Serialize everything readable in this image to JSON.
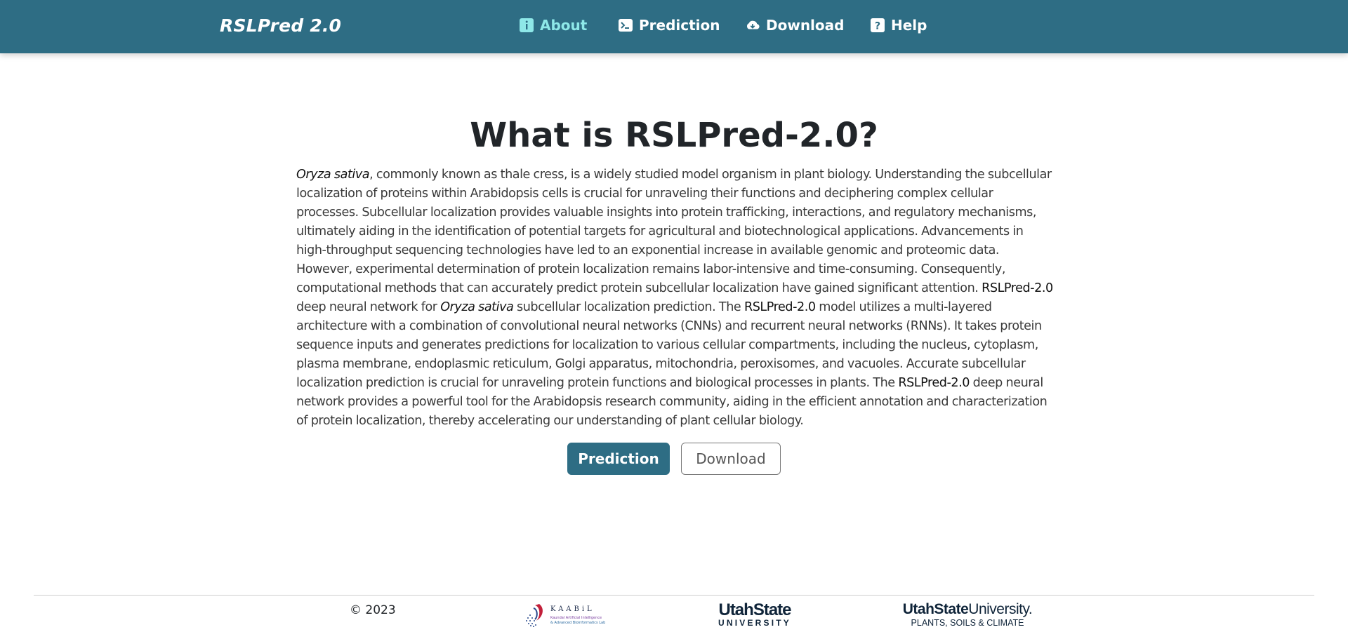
{
  "brand": "RSLPred 2.0",
  "nav": {
    "items": [
      {
        "label": "About",
        "icon": "info-icon",
        "active": true
      },
      {
        "label": "Prediction",
        "icon": "terminal-icon",
        "active": false
      },
      {
        "label": "Download",
        "icon": "cloud-download-icon",
        "active": false
      },
      {
        "label": "Help",
        "icon": "question-icon",
        "active": false
      }
    ]
  },
  "main": {
    "title": "What is RSLPred-2.0?",
    "paragraph": {
      "p1_em": "Oryza sativa",
      "p2": ", commonly known as thale cress, is a widely studied model organism in plant biology. Understanding the subcellular localization of proteins within Arabidopsis cells is crucial for unraveling their functions and deciphering complex cellular processes. Subcellular localization provides valuable insights into protein trafficking, interactions, and regulatory mechanisms, ultimately aiding in the identification of potential targets for agricultural and biotechnological applications. Advancements in high-throughput sequencing technologies have led to an exponential increase in available genomic and proteomic data. However, experimental determination of protein localization remains labor-intensive and time-consuming. Consequently, computational methods that can accurately predict protein subcellular localization have gained significant attention. ",
      "p3_strong": "RSLPred-2.0",
      "p4": " deep neural network for ",
      "p5_em": "Oryza sativa",
      "p6": " subcellular localization prediction. The ",
      "p7_strong": "RSLPred-2.0",
      "p8": " model utilizes a multi-layered architecture with a combination of convolutional neural networks (CNNs) and recurrent neural networks (RNNs). It takes protein sequence inputs and generates predictions for localization to various cellular compartments, including the nucleus, cytoplasm, plasma membrane, endoplasmic reticulum, Golgi apparatus, mitochondria, peroxisomes, and vacuoles. Accurate subcellular localization prediction is crucial for unraveling protein functions and biological processes in plants. The ",
      "p9_strong": "RSLPred-2.0",
      "p10": " deep neural network provides a powerful tool for the Arabidopsis research community, aiding in the efficient annotation and characterization of protein localization, thereby accelerating our understanding of plant cellular biology."
    },
    "buttons": {
      "prediction": "Prediction",
      "download": "Download"
    }
  },
  "footer": {
    "copyright": "© 2023",
    "logos": {
      "kaabil_name": "KAABiL",
      "kaabil_sub1": "Kaundal Artificial Intelligence",
      "kaabil_sub2": "& Advanced Bioinformatics Lab",
      "usu_stacked_top": "UtahState",
      "usu_stacked_bottom": "UNIVERSITY",
      "usu_psc_bold": "UtahState",
      "usu_psc_light": "University.",
      "usu_psc_dept": "PLANTS, SOILS & CLIMATE"
    }
  },
  "colors": {
    "navbar": "#2e6d84",
    "active_nav": "#8ee8e8",
    "primary_button": "#2e6d84",
    "usu_navy": "#0f2439"
  }
}
